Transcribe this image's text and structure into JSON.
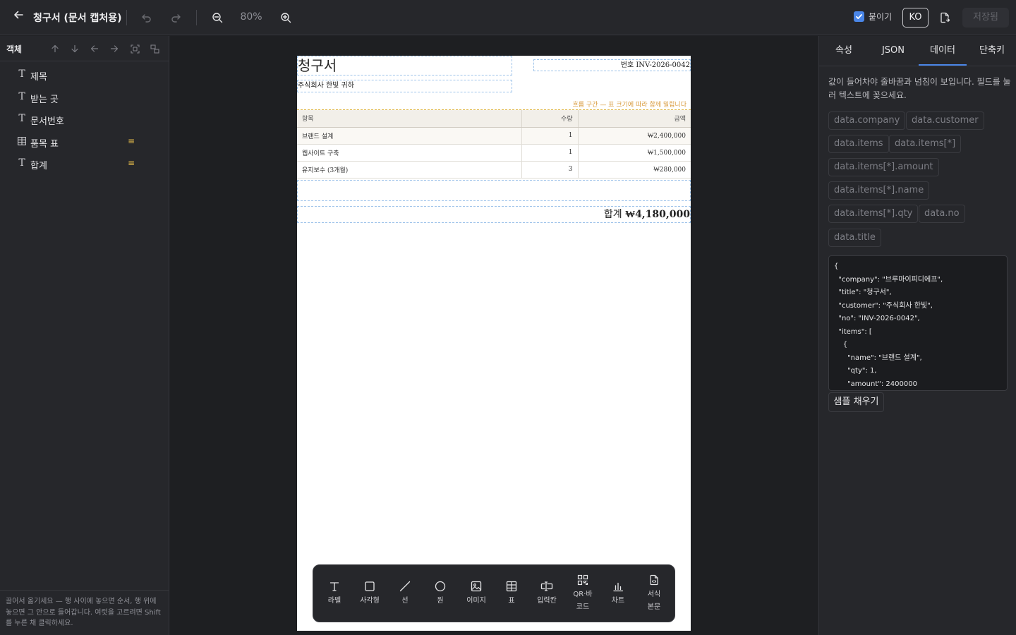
{
  "topbar": {
    "title": "청구서 (문서 캡처용)",
    "zoom": "80%",
    "paste_label": "붙이기",
    "paste_checked": true,
    "lang": "KO",
    "save_label": "저장됨"
  },
  "left": {
    "title": "객체",
    "objects": [
      {
        "label": "제목",
        "icon": "text-icon",
        "badge": ""
      },
      {
        "label": "받는 곳",
        "icon": "text-icon",
        "badge": ""
      },
      {
        "label": "문서번호",
        "icon": "text-icon",
        "badge": ""
      },
      {
        "label": "품목 표",
        "icon": "table-icon",
        "badge": "≡"
      },
      {
        "label": "합계",
        "icon": "text-icon",
        "badge": "≡"
      }
    ],
    "footer": "끌어서 옮기세요 — 행 사이에 놓으면 순서, 행 위에 놓으면 그 안으로 들어갑니다. 여럿을 고르려면 Shift를 누른 채 클릭하세요."
  },
  "document": {
    "title": "청구서",
    "number": "번호 INV-2026-0042",
    "customer": "주식회사 한빛 귀하",
    "flow_note": "흐름 구간 — 표 크기에 따라 함께 밀립니다",
    "table_headers": [
      "항목",
      "수량",
      "금액"
    ],
    "rows": [
      {
        "name": "브랜드 설계",
        "qty": "1",
        "amount": "₩2,400,000"
      },
      {
        "name": "웹사이트 구축",
        "qty": "1",
        "amount": "₩1,500,000"
      },
      {
        "name": "유지보수 (3개월)",
        "qty": "3",
        "amount": "₩280,000"
      }
    ],
    "total_label": "합계 ",
    "total_value": "₩4,180,000"
  },
  "toolbar": {
    "tools": [
      {
        "label": "라벨",
        "icon": "text-icon"
      },
      {
        "label": "사각형",
        "icon": "rectangle-icon"
      },
      {
        "label": "선",
        "icon": "line-icon"
      },
      {
        "label": "원",
        "icon": "circle-icon"
      },
      {
        "label": "이미지",
        "icon": "image-icon"
      },
      {
        "label": "표",
        "icon": "table-icon"
      },
      {
        "label": "입력칸",
        "icon": "input-icon"
      },
      {
        "label": "QR·바코드",
        "line1": "QR·바",
        "line2": "코드",
        "icon": "qr-icon"
      },
      {
        "label": "차트",
        "icon": "chart-icon"
      },
      {
        "label": "서식본문",
        "line1": "서식",
        "line2": "본문",
        "icon": "document-icon"
      }
    ]
  },
  "right": {
    "tabs": [
      "속성",
      "JSON",
      "데이터",
      "단축키"
    ],
    "active_tab": "데이터",
    "help": "값이 들어차야 줄바꿈과 넘침이 보입니다. 필드를 눌러 텍스트에 꽂으세요.",
    "fields": [
      "data.company",
      "data.customer",
      "data.items",
      "data.items[*]",
      "data.items[*].amount",
      "data.items[*].name",
      "data.items[*].qty",
      "data.no",
      "data.title"
    ],
    "json_text": "{\n  \"company\": \"브루마이피디에프\",\n  \"title\": \"청구서\",\n  \"customer\": \"주식회사 한빛\",\n  \"no\": \"INV-2026-0042\",\n  \"items\": [\n    {\n      \"name\": \"브랜드 설계\",\n      \"qty\": 1,\n      \"amount\": 2400000",
    "fill_label": "샘플 채우기"
  },
  "colors": {
    "accent": "#4a86e8",
    "badge": "#e0b84a",
    "flow_note": "#d89a3c",
    "guide": "#9ec3ea"
  }
}
